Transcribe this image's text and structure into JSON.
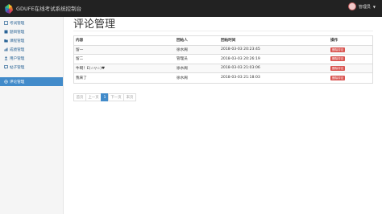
{
  "brand": {
    "title": "GDUFE在线考试系统控制台"
  },
  "user": {
    "name": "管理员"
  },
  "sidebar": {
    "items": [
      {
        "label": "考试管理",
        "icon": "file-icon"
      },
      {
        "label": "题目管理",
        "icon": "book-icon"
      },
      {
        "label": "课程管理",
        "icon": "folder-icon"
      },
      {
        "label": "成绩管理",
        "icon": "chart-icon"
      },
      {
        "label": "用户管理",
        "icon": "user-icon"
      },
      {
        "label": "帖子管理",
        "icon": "post-icon"
      },
      {
        "label": "评论管理",
        "icon": "comment-icon",
        "active": true
      }
    ]
  },
  "page": {
    "title": "评论管理"
  },
  "table": {
    "headers": [
      "内容",
      "回帖人",
      "回帖时间",
      "操作"
    ],
    "rows": [
      {
        "content": "留一",
        "author": "徐水阁",
        "time": "2018-03-03 20:23:45",
        "action": "删除评论"
      },
      {
        "content": "留二",
        "author": "管理员",
        "time": "2018-03-03 20:26:19",
        "action": "删除评论"
      },
      {
        "content": "牛啊！E(☆▽☆)♥",
        "author": "徐水阁",
        "time": "2018-03-03 21:03:06",
        "action": "删除评论"
      },
      {
        "content": "我来了",
        "author": "徐水阁",
        "time": "2018-03-03 21:18:03",
        "action": "删除评论"
      }
    ]
  },
  "pagination": {
    "first": "首页",
    "prev": "上一页",
    "current": "1",
    "next": "下一页",
    "last": "末页"
  },
  "colors": {
    "accent": "#428bca",
    "danger": "#d9534f",
    "topbar": "#222222"
  }
}
